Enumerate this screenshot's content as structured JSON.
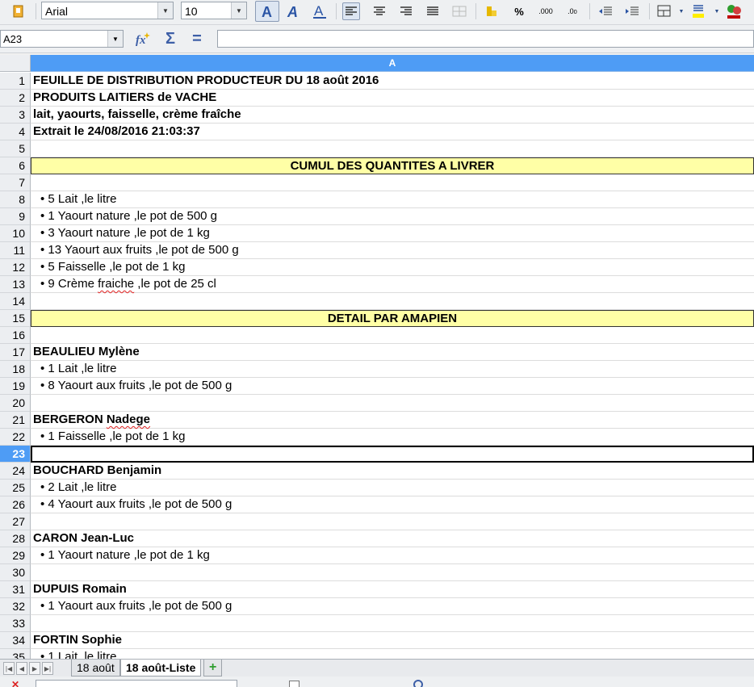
{
  "toolbar": {
    "font_name": "Arial",
    "font_size": "10"
  },
  "formula_bar": {
    "cell_reference": "A23",
    "formula": ""
  },
  "column_header": "A",
  "rows": [
    {
      "num": "1",
      "text": "FEUILLE DE DISTRIBUTION PRODUCTEUR DU 18 août 2016",
      "style": "bold"
    },
    {
      "num": "2",
      "text": "PRODUITS LAITIERS de VACHE",
      "style": "bold"
    },
    {
      "num": "3",
      "text": "lait, yaourts, faisselle, crème fraîche",
      "style": "bold"
    },
    {
      "num": "4",
      "text": "Extrait le 24/08/2016 21:03:37",
      "style": "bold"
    },
    {
      "num": "5",
      "text": "",
      "style": ""
    },
    {
      "num": "6",
      "text": "CUMUL DES QUANTITES A LIVRER",
      "style": "banner"
    },
    {
      "num": "7",
      "text": "",
      "style": ""
    },
    {
      "num": "8",
      "text": "• 5 Lait ,le litre",
      "style": "bullet"
    },
    {
      "num": "9",
      "text": "• 1 Yaourt nature ,le pot de 500 g",
      "style": "bullet"
    },
    {
      "num": "10",
      "text": "• 3 Yaourt nature ,le pot de 1 kg",
      "style": "bullet"
    },
    {
      "num": "11",
      "text": "• 13 Yaourt aux fruits ,le pot de 500 g",
      "style": "bullet"
    },
    {
      "num": "12",
      "text": "• 5 Faisselle ,le pot de 1 kg",
      "style": "bullet"
    },
    {
      "num": "13",
      "text": "• 9 Crème fraiche ,le pot de 25 cl",
      "style": "bullet"
    },
    {
      "num": "14",
      "text": "",
      "style": ""
    },
    {
      "num": "15",
      "text": "DETAIL PAR AMAPIEN",
      "style": "banner"
    },
    {
      "num": "16",
      "text": "",
      "style": ""
    },
    {
      "num": "17",
      "text": "BEAULIEU Mylène",
      "style": "bold"
    },
    {
      "num": "18",
      "text": "• 1 Lait ,le litre",
      "style": "bullet"
    },
    {
      "num": "19",
      "text": "• 8 Yaourt aux fruits ,le pot de 500 g",
      "style": "bullet"
    },
    {
      "num": "20",
      "text": "",
      "style": ""
    },
    {
      "num": "21",
      "text": "BERGERON Nadege",
      "style": "bold"
    },
    {
      "num": "22",
      "text": "• 1 Faisselle ,le pot de 1 kg",
      "style": "bullet"
    },
    {
      "num": "23",
      "text": "",
      "style": "selected"
    },
    {
      "num": "24",
      "text": "BOUCHARD Benjamin",
      "style": "bold"
    },
    {
      "num": "25",
      "text": "• 2 Lait ,le litre",
      "style": "bullet"
    },
    {
      "num": "26",
      "text": "• 4 Yaourt aux fruits ,le pot de 500 g",
      "style": "bullet"
    },
    {
      "num": "27",
      "text": "",
      "style": ""
    },
    {
      "num": "28",
      "text": "CARON Jean-Luc",
      "style": "bold"
    },
    {
      "num": "29",
      "text": "• 1 Yaourt nature ,le pot de 1 kg",
      "style": "bullet"
    },
    {
      "num": "30",
      "text": "",
      "style": ""
    },
    {
      "num": "31",
      "text": "DUPUIS Romain",
      "style": "bold"
    },
    {
      "num": "32",
      "text": "• 1 Yaourt aux fruits ,le pot de 500 g",
      "style": "bullet"
    },
    {
      "num": "33",
      "text": "",
      "style": ""
    },
    {
      "num": "34",
      "text": "FORTIN Sophie",
      "style": "bold"
    },
    {
      "num": "35",
      "text": "• 1 Lait ,le litre",
      "style": "bullet"
    }
  ],
  "active_row": "23",
  "sheet_tabs": [
    {
      "label": "18 août",
      "active": false
    },
    {
      "label": "18 août-Liste",
      "active": true
    }
  ],
  "add_tab_label": "+",
  "colors": {
    "header_blue": "#4e9cf5",
    "banner_yellow": "#ffffa6"
  }
}
